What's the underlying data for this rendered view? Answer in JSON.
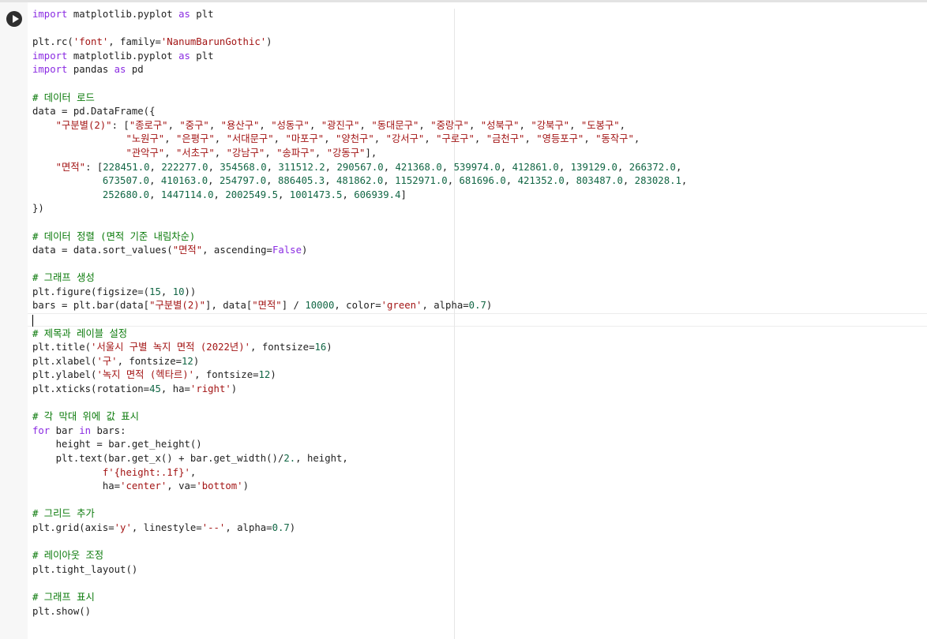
{
  "cell": {
    "run_button_label": "",
    "code_lines": [
      [
        {
          "t": "import",
          "c": "kw"
        },
        {
          "t": " matplotlib.pyplot ",
          "c": ""
        },
        {
          "t": "as",
          "c": "kw"
        },
        {
          "t": " plt",
          "c": ""
        }
      ],
      [],
      [
        {
          "t": "plt.rc(",
          "c": ""
        },
        {
          "t": "'font'",
          "c": "str"
        },
        {
          "t": ", family=",
          "c": ""
        },
        {
          "t": "'NanumBarunGothic'",
          "c": "str"
        },
        {
          "t": ")",
          "c": ""
        }
      ],
      [
        {
          "t": "import",
          "c": "kw"
        },
        {
          "t": " matplotlib.pyplot ",
          "c": ""
        },
        {
          "t": "as",
          "c": "kw"
        },
        {
          "t": " plt",
          "c": ""
        }
      ],
      [
        {
          "t": "import",
          "c": "kw"
        },
        {
          "t": " pandas ",
          "c": ""
        },
        {
          "t": "as",
          "c": "kw"
        },
        {
          "t": " pd",
          "c": ""
        }
      ],
      [],
      [
        {
          "t": "# 데이터 로드",
          "c": "com"
        }
      ],
      [
        {
          "t": "data = pd.DataFrame({",
          "c": ""
        }
      ],
      [
        {
          "t": "    ",
          "c": ""
        },
        {
          "t": "\"구분별(2)\"",
          "c": "str"
        },
        {
          "t": ": [",
          "c": ""
        },
        {
          "t": "\"종로구\"",
          "c": "str"
        },
        {
          "t": ", ",
          "c": ""
        },
        {
          "t": "\"중구\"",
          "c": "str"
        },
        {
          "t": ", ",
          "c": ""
        },
        {
          "t": "\"용산구\"",
          "c": "str"
        },
        {
          "t": ", ",
          "c": ""
        },
        {
          "t": "\"성동구\"",
          "c": "str"
        },
        {
          "t": ", ",
          "c": ""
        },
        {
          "t": "\"광진구\"",
          "c": "str"
        },
        {
          "t": ", ",
          "c": ""
        },
        {
          "t": "\"동대문구\"",
          "c": "str"
        },
        {
          "t": ", ",
          "c": ""
        },
        {
          "t": "\"중랑구\"",
          "c": "str"
        },
        {
          "t": ", ",
          "c": ""
        },
        {
          "t": "\"성북구\"",
          "c": "str"
        },
        {
          "t": ", ",
          "c": ""
        },
        {
          "t": "\"강북구\"",
          "c": "str"
        },
        {
          "t": ", ",
          "c": ""
        },
        {
          "t": "\"도봉구\"",
          "c": "str"
        },
        {
          "t": ",",
          "c": ""
        }
      ],
      [
        {
          "t": "                ",
          "c": ""
        },
        {
          "t": "\"노원구\"",
          "c": "str"
        },
        {
          "t": ", ",
          "c": ""
        },
        {
          "t": "\"은평구\"",
          "c": "str"
        },
        {
          "t": ", ",
          "c": ""
        },
        {
          "t": "\"서대문구\"",
          "c": "str"
        },
        {
          "t": ", ",
          "c": ""
        },
        {
          "t": "\"마포구\"",
          "c": "str"
        },
        {
          "t": ", ",
          "c": ""
        },
        {
          "t": "\"양천구\"",
          "c": "str"
        },
        {
          "t": ", ",
          "c": ""
        },
        {
          "t": "\"강서구\"",
          "c": "str"
        },
        {
          "t": ", ",
          "c": ""
        },
        {
          "t": "\"구로구\"",
          "c": "str"
        },
        {
          "t": ", ",
          "c": ""
        },
        {
          "t": "\"금천구\"",
          "c": "str"
        },
        {
          "t": ", ",
          "c": ""
        },
        {
          "t": "\"영등포구\"",
          "c": "str"
        },
        {
          "t": ", ",
          "c": ""
        },
        {
          "t": "\"동작구\"",
          "c": "str"
        },
        {
          "t": ",",
          "c": ""
        }
      ],
      [
        {
          "t": "                ",
          "c": ""
        },
        {
          "t": "\"관악구\"",
          "c": "str"
        },
        {
          "t": ", ",
          "c": ""
        },
        {
          "t": "\"서초구\"",
          "c": "str"
        },
        {
          "t": ", ",
          "c": ""
        },
        {
          "t": "\"강남구\"",
          "c": "str"
        },
        {
          "t": ", ",
          "c": ""
        },
        {
          "t": "\"송파구\"",
          "c": "str"
        },
        {
          "t": ", ",
          "c": ""
        },
        {
          "t": "\"강동구\"",
          "c": "str"
        },
        {
          "t": "],",
          "c": ""
        }
      ],
      [
        {
          "t": "    ",
          "c": ""
        },
        {
          "t": "\"면적\"",
          "c": "str"
        },
        {
          "t": ": [",
          "c": ""
        },
        {
          "t": "228451.0",
          "c": "num"
        },
        {
          "t": ", ",
          "c": ""
        },
        {
          "t": "222277.0",
          "c": "num"
        },
        {
          "t": ", ",
          "c": ""
        },
        {
          "t": "354568.0",
          "c": "num"
        },
        {
          "t": ", ",
          "c": ""
        },
        {
          "t": "311512.2",
          "c": "num"
        },
        {
          "t": ", ",
          "c": ""
        },
        {
          "t": "290567.0",
          "c": "num"
        },
        {
          "t": ", ",
          "c": ""
        },
        {
          "t": "421368.0",
          "c": "num"
        },
        {
          "t": ", ",
          "c": ""
        },
        {
          "t": "539974.0",
          "c": "num"
        },
        {
          "t": ", ",
          "c": ""
        },
        {
          "t": "412861.0",
          "c": "num"
        },
        {
          "t": ", ",
          "c": ""
        },
        {
          "t": "139129.0",
          "c": "num"
        },
        {
          "t": ", ",
          "c": ""
        },
        {
          "t": "266372.0",
          "c": "num"
        },
        {
          "t": ",",
          "c": ""
        }
      ],
      [
        {
          "t": "            ",
          "c": ""
        },
        {
          "t": "673507.0",
          "c": "num"
        },
        {
          "t": ", ",
          "c": ""
        },
        {
          "t": "410163.0",
          "c": "num"
        },
        {
          "t": ", ",
          "c": ""
        },
        {
          "t": "254797.0",
          "c": "num"
        },
        {
          "t": ", ",
          "c": ""
        },
        {
          "t": "886405.3",
          "c": "num"
        },
        {
          "t": ", ",
          "c": ""
        },
        {
          "t": "481862.0",
          "c": "num"
        },
        {
          "t": ", ",
          "c": ""
        },
        {
          "t": "1152971.0",
          "c": "num"
        },
        {
          "t": ", ",
          "c": ""
        },
        {
          "t": "681696.0",
          "c": "num"
        },
        {
          "t": ", ",
          "c": ""
        },
        {
          "t": "421352.0",
          "c": "num"
        },
        {
          "t": ", ",
          "c": ""
        },
        {
          "t": "803487.0",
          "c": "num"
        },
        {
          "t": ", ",
          "c": ""
        },
        {
          "t": "283028.1",
          "c": "num"
        },
        {
          "t": ",",
          "c": ""
        }
      ],
      [
        {
          "t": "            ",
          "c": ""
        },
        {
          "t": "252680.0",
          "c": "num"
        },
        {
          "t": ", ",
          "c": ""
        },
        {
          "t": "1447114.0",
          "c": "num"
        },
        {
          "t": ", ",
          "c": ""
        },
        {
          "t": "2002549.5",
          "c": "num"
        },
        {
          "t": ", ",
          "c": ""
        },
        {
          "t": "1001473.5",
          "c": "num"
        },
        {
          "t": ", ",
          "c": ""
        },
        {
          "t": "606939.4",
          "c": "num"
        },
        {
          "t": "]",
          "c": ""
        }
      ],
      [
        {
          "t": "})",
          "c": ""
        }
      ],
      [],
      [
        {
          "t": "# 데이터 정렬 (면적 기준 내림차순)",
          "c": "com"
        }
      ],
      [
        {
          "t": "data = data.sort_values(",
          "c": ""
        },
        {
          "t": "\"면적\"",
          "c": "str"
        },
        {
          "t": ", ascending=",
          "c": ""
        },
        {
          "t": "False",
          "c": "kw"
        },
        {
          "t": ")",
          "c": ""
        }
      ],
      [],
      [
        {
          "t": "# 그래프 생성",
          "c": "com"
        }
      ],
      [
        {
          "t": "plt.figure(figsize=(",
          "c": ""
        },
        {
          "t": "15",
          "c": "num"
        },
        {
          "t": ", ",
          "c": ""
        },
        {
          "t": "10",
          "c": "num"
        },
        {
          "t": "))",
          "c": ""
        }
      ],
      [
        {
          "t": "bars = plt.bar(data[",
          "c": ""
        },
        {
          "t": "\"구분별(2)\"",
          "c": "str"
        },
        {
          "t": "], data[",
          "c": ""
        },
        {
          "t": "\"면적\"",
          "c": "str"
        },
        {
          "t": "] / ",
          "c": ""
        },
        {
          "t": "10000",
          "c": "num"
        },
        {
          "t": ", color=",
          "c": ""
        },
        {
          "t": "'green'",
          "c": "str"
        },
        {
          "t": ", alpha=",
          "c": ""
        },
        {
          "t": "0.7",
          "c": "num"
        },
        {
          "t": ")",
          "c": ""
        }
      ],
      [],
      [
        {
          "t": "# 제목과 레이블 설정",
          "c": "com"
        }
      ],
      [
        {
          "t": "plt.title(",
          "c": ""
        },
        {
          "t": "'서울시 구별 녹지 면적 (2022년)'",
          "c": "str"
        },
        {
          "t": ", fontsize=",
          "c": ""
        },
        {
          "t": "16",
          "c": "num"
        },
        {
          "t": ")",
          "c": ""
        }
      ],
      [
        {
          "t": "plt.xlabel(",
          "c": ""
        },
        {
          "t": "'구'",
          "c": "str"
        },
        {
          "t": ", fontsize=",
          "c": ""
        },
        {
          "t": "12",
          "c": "num"
        },
        {
          "t": ")",
          "c": ""
        }
      ],
      [
        {
          "t": "plt.ylabel(",
          "c": ""
        },
        {
          "t": "'녹지 면적 (헥타르)'",
          "c": "str"
        },
        {
          "t": ", fontsize=",
          "c": ""
        },
        {
          "t": "12",
          "c": "num"
        },
        {
          "t": ")",
          "c": ""
        }
      ],
      [
        {
          "t": "plt.xticks(rotation=",
          "c": ""
        },
        {
          "t": "45",
          "c": "num"
        },
        {
          "t": ", ha=",
          "c": ""
        },
        {
          "t": "'right'",
          "c": "str"
        },
        {
          "t": ")",
          "c": ""
        }
      ],
      [],
      [
        {
          "t": "# 각 막대 위에 값 표시",
          "c": "com"
        }
      ],
      [
        {
          "t": "for",
          "c": "kw"
        },
        {
          "t": " bar ",
          "c": ""
        },
        {
          "t": "in",
          "c": "kw"
        },
        {
          "t": " bars:",
          "c": ""
        }
      ],
      [
        {
          "t": "    height = bar.get_height()",
          "c": ""
        }
      ],
      [
        {
          "t": "    plt.text(bar.get_x() + bar.get_width()/",
          "c": ""
        },
        {
          "t": "2.",
          "c": "num"
        },
        {
          "t": ", height,",
          "c": ""
        }
      ],
      [
        {
          "t": "            ",
          "c": ""
        },
        {
          "t": "f'{height:.1f}'",
          "c": "str"
        },
        {
          "t": ",",
          "c": ""
        }
      ],
      [
        {
          "t": "            ha=",
          "c": ""
        },
        {
          "t": "'center'",
          "c": "str"
        },
        {
          "t": ", va=",
          "c": ""
        },
        {
          "t": "'bottom'",
          "c": "str"
        },
        {
          "t": ")",
          "c": ""
        }
      ],
      [],
      [
        {
          "t": "# 그리드 추가",
          "c": "com"
        }
      ],
      [
        {
          "t": "plt.grid(axis=",
          "c": ""
        },
        {
          "t": "'y'",
          "c": "str"
        },
        {
          "t": ", linestyle=",
          "c": ""
        },
        {
          "t": "'--'",
          "c": "str"
        },
        {
          "t": ", alpha=",
          "c": ""
        },
        {
          "t": "0.7",
          "c": "num"
        },
        {
          "t": ")",
          "c": ""
        }
      ],
      [],
      [
        {
          "t": "# 레이아웃 조정",
          "c": "com"
        }
      ],
      [
        {
          "t": "plt.tight_layout()",
          "c": ""
        }
      ],
      [],
      [
        {
          "t": "# 그래프 표시",
          "c": "com"
        }
      ],
      [
        {
          "t": "plt.show()",
          "c": ""
        }
      ]
    ]
  },
  "icons": {
    "run": "play-circle-icon"
  }
}
